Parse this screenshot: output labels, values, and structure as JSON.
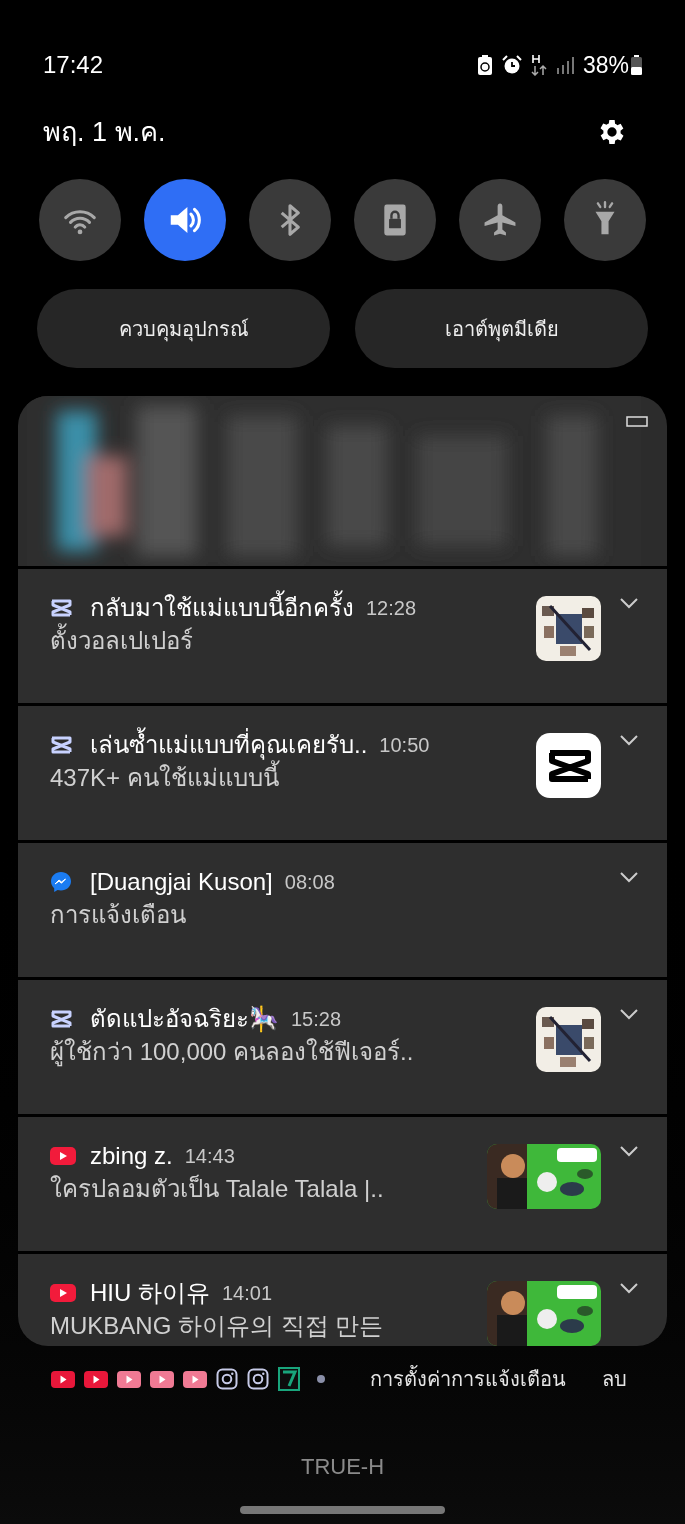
{
  "status_bar": {
    "time": "17:42",
    "battery": "38%"
  },
  "date": "พฤ. 1 พ.ค.",
  "quick_toggles": [
    {
      "kind": "wifi",
      "on": false
    },
    {
      "kind": "sound",
      "on": true
    },
    {
      "kind": "bluetooth",
      "on": false
    },
    {
      "kind": "rotation_lock",
      "on": false
    },
    {
      "kind": "airplane",
      "on": false
    },
    {
      "kind": "flashlight",
      "on": false
    }
  ],
  "buttons": [
    "ควบคุมอุปกรณ์",
    "เอาต์พุตมีเดีย"
  ],
  "notifications": [
    {
      "kind": "capcut",
      "title": "กลับมาใช้แม่แบบนี้อีกครั้ง",
      "time": "12:28",
      "body": "ตั้งวอลเปเปอร์"
    },
    {
      "kind": "capcut",
      "title": "เล่นซ้ำแม่แบบที่คุณเคยรับ..",
      "time": "10:50",
      "body": "437K+ คนใช้แม่แบบนี้",
      "thumbnail": {
        "kind": "app_logo"
      }
    },
    {
      "kind": "messenger",
      "title": "[Duangjai Kuson]",
      "time": "08:08",
      "body": "การแจ้งเตือน"
    },
    {
      "kind": "capcut",
      "title": "ตัดแปะอัจฉริยะ🎠",
      "time": "15:28",
      "body": "ผู้ใช้กว่า 100,000 คนลองใช้ฟีเจอร์.."
    },
    {
      "kind": "youtube",
      "title": "zbing z.",
      "time": "14:43",
      "body": "ใครปลอมตัวเป็น Talale Talala |.."
    },
    {
      "kind": "youtube",
      "title": "HIU 하이유",
      "time": "14:01",
      "body": "MUKBANG 하이유의 직접 만든"
    }
  ],
  "footer_icons": [
    {
      "kind": "youtube",
      "color": "#e8173a"
    },
    {
      "kind": "youtube",
      "color": "#e8173a"
    },
    {
      "kind": "youtube",
      "color": "#f07a94"
    },
    {
      "kind": "youtube",
      "color": "#f07a94"
    },
    {
      "kind": "youtube",
      "color": "#f07a94"
    },
    {
      "kind": "instagram",
      "color": "#c7cbe8"
    },
    {
      "kind": "instagram",
      "color": "#c7cbe8"
    },
    {
      "kind": "seven_eleven",
      "color": "#19a57c"
    }
  ],
  "footer_actions": [
    "การตั้งค่าการแจ้งเตือน",
    "ลบ"
  ],
  "carrier": "TRUE-H"
}
